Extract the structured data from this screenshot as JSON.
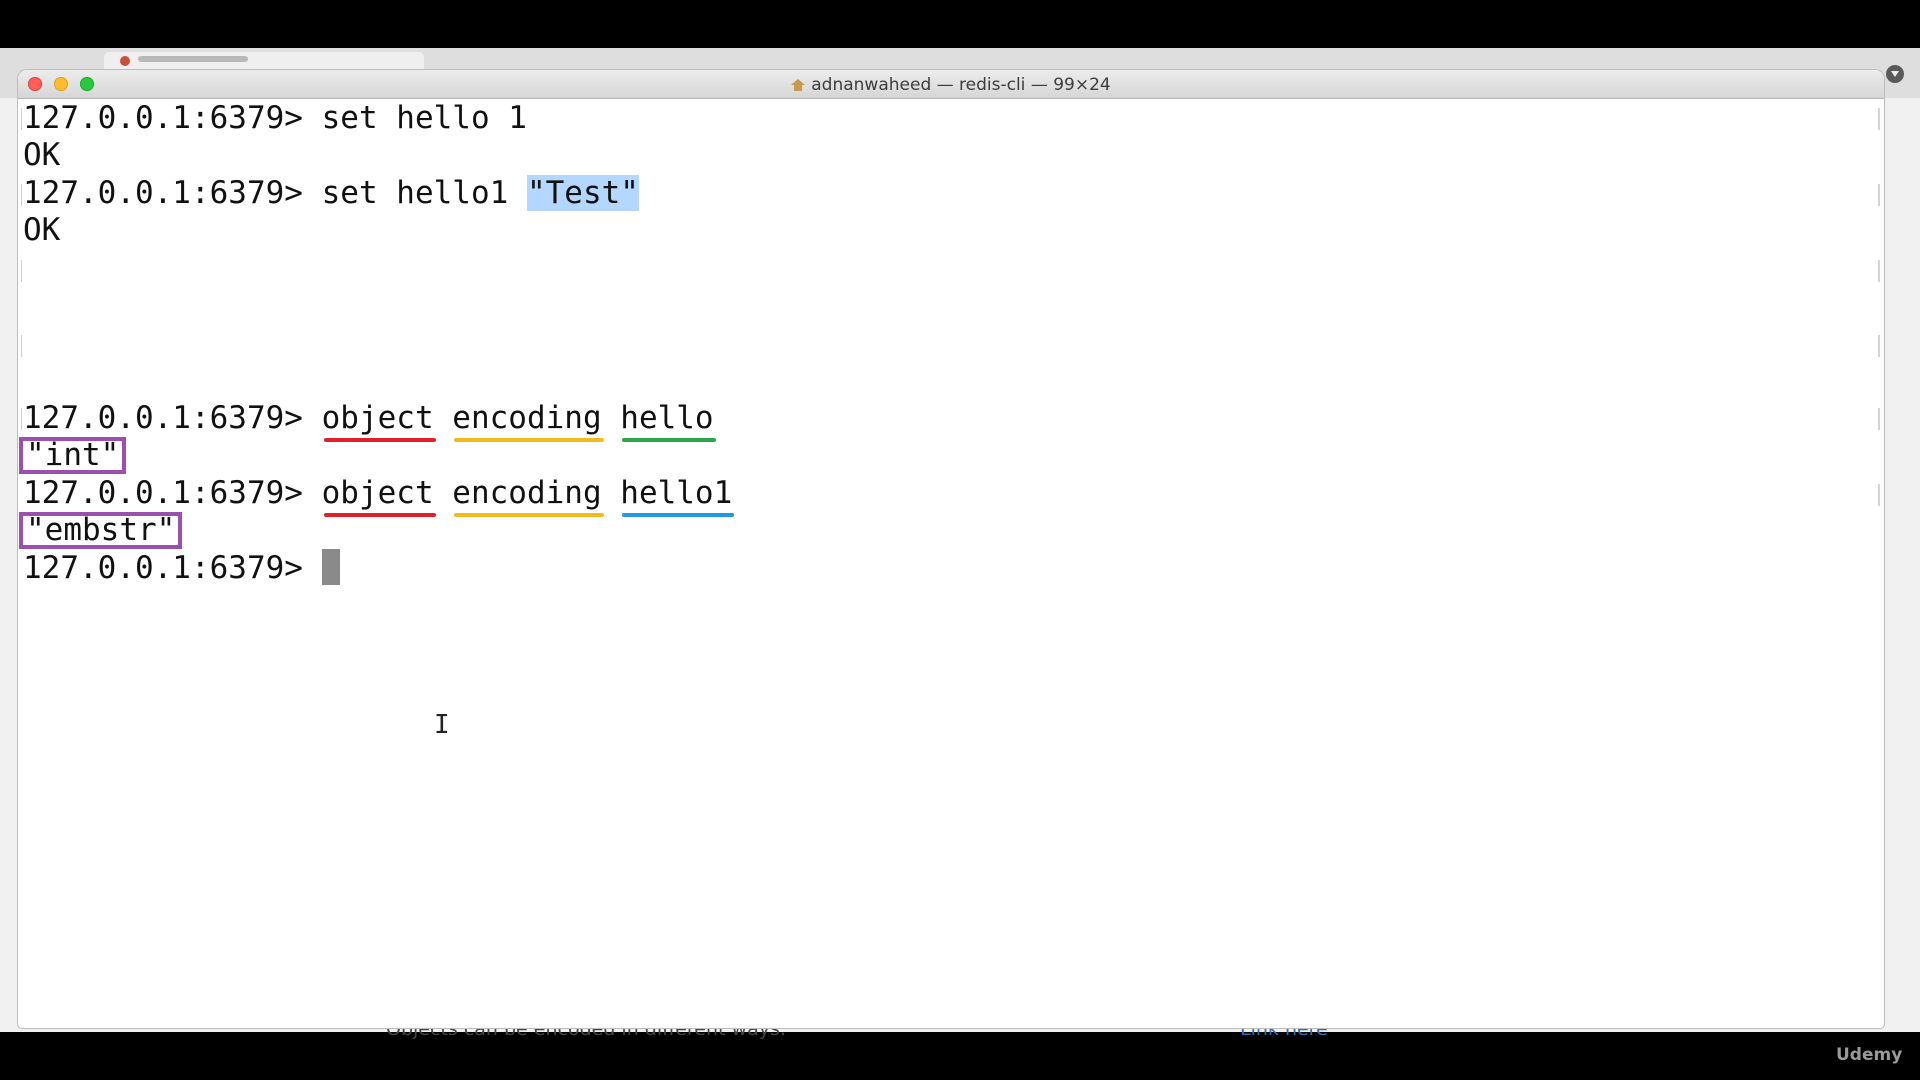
{
  "window": {
    "title": "adnanwaheed — redis-cli — 99×24"
  },
  "terminal": {
    "prompt": "127.0.0.1:6379>",
    "lines": {
      "l1_cmd": "set hello 1",
      "l2_out": "OK",
      "l3_cmd_a": "set hello1 ",
      "l3_cmd_sel": "\"Test\"",
      "l4_out": "OK",
      "l5_w1": "object",
      "l5_w2": "encoding",
      "l5_w3": "hello",
      "l6_out": "\"int\"",
      "l7_w1": "object",
      "l7_w2": "encoding",
      "l7_w3": "hello1",
      "l8_out": "\"embstr\""
    }
  },
  "browser": {
    "caption": "Objects can be encoded in different ways:",
    "link": "Link here"
  },
  "watermark": "Udemy",
  "colors": {
    "underline_red": "#e0212a",
    "underline_yellow": "#f4b91c",
    "underline_green": "#2aa54a",
    "underline_blue": "#1f9ae0",
    "box_purple": "#9b4fb0",
    "selection": "#b3d7ff"
  },
  "icons": [
    "close-button",
    "minimize-button",
    "maximize-button",
    "home-icon",
    "text-cursor-icon",
    "dropdown-icon"
  ]
}
